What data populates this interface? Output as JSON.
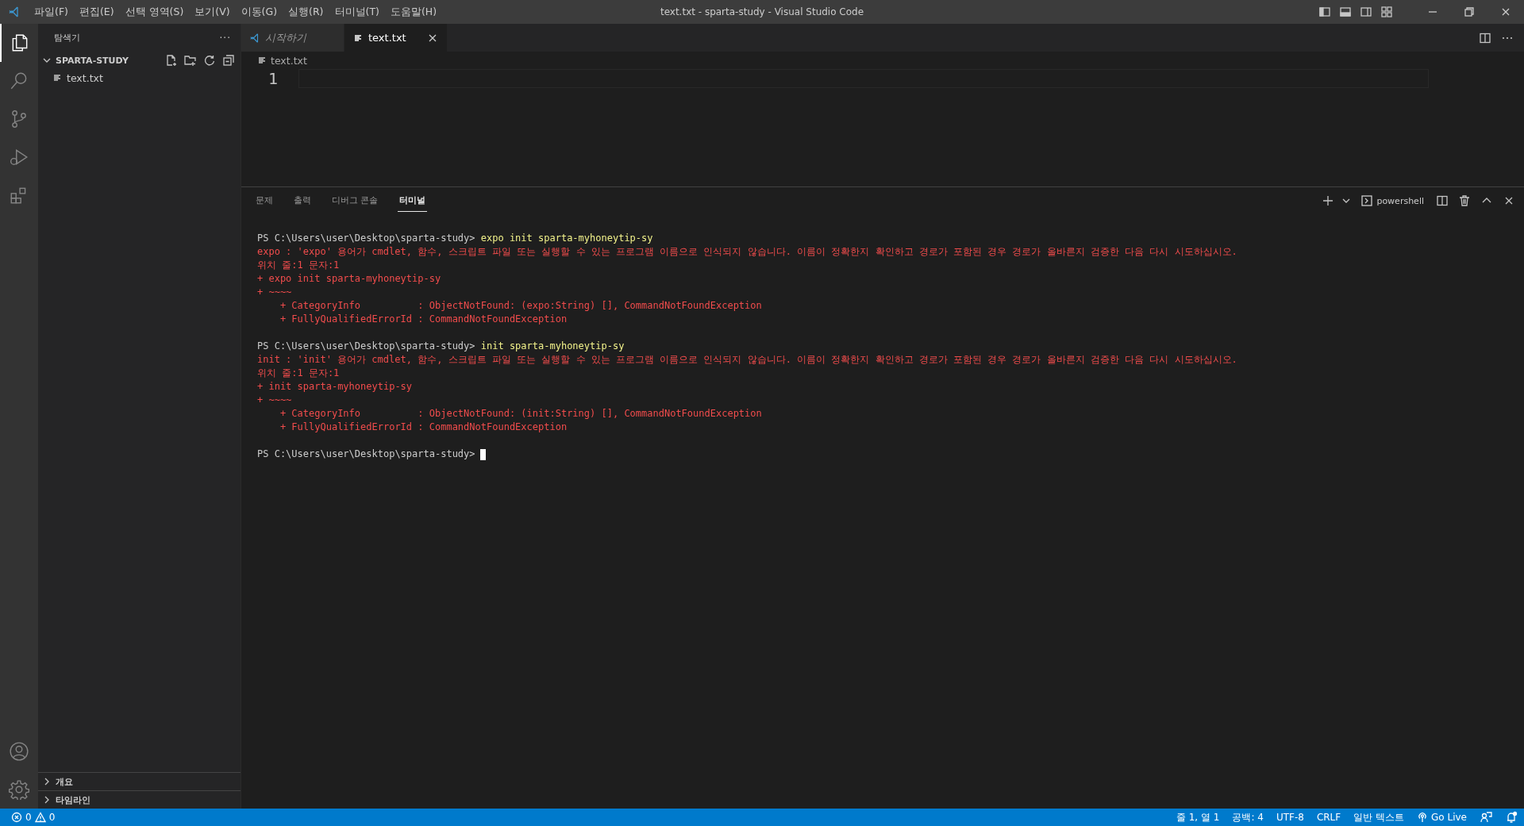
{
  "title_bar": {
    "menu": [
      "파일(F)",
      "편집(E)",
      "선택 영역(S)",
      "보기(V)",
      "이동(G)",
      "실행(R)",
      "터미널(T)",
      "도움말(H)"
    ],
    "title": "text.txt - sparta-study - Visual Studio Code"
  },
  "activity_bar": [
    {
      "kind": "files",
      "selected": true
    },
    {
      "kind": "search",
      "selected": false
    },
    {
      "kind": "source-control",
      "selected": false
    },
    {
      "kind": "run",
      "selected": false
    },
    {
      "kind": "extensions",
      "selected": false
    }
  ],
  "activity_bottom": [
    {
      "kind": "account"
    },
    {
      "kind": "settings"
    }
  ],
  "sidebar": {
    "title": "탐색기",
    "more": "···",
    "folder": {
      "name": "SPARTA-STUDY",
      "expanded": true,
      "children": [
        {
          "name": "text.txt"
        }
      ]
    },
    "sections": [
      {
        "name": "개요",
        "expanded": false
      },
      {
        "name": "타임라인",
        "expanded": false
      }
    ]
  },
  "tabs": [
    {
      "label": "시작하기",
      "kind": "welcome",
      "preview": true,
      "selected": false
    },
    {
      "label": "text.txt",
      "kind": "file",
      "preview": false,
      "selected": true
    }
  ],
  "breadcrumb": "text.txt",
  "editor": {
    "lines": [
      "1"
    ]
  },
  "panel": {
    "tabs": [
      {
        "label": "문제",
        "selected": false
      },
      {
        "label": "출력",
        "selected": false
      },
      {
        "label": "디버그 콘솔",
        "selected": false
      },
      {
        "label": "터미널",
        "selected": true
      }
    ],
    "shell": "powershell",
    "terminal": [
      [
        {
          "kind": "prompt",
          "path": "PS C:\\Users\\user\\Desktop\\sparta-study>",
          "command": "expo init sparta-myhoneytip-sy"
        },
        {
          "kind": "error",
          "text": "expo : 'expo' 용어가 cmdlet, 함수, 스크립트 파일 또는 실행할 수 있는 프로그램 이름으로 인식되지 않습니다. 이름이 정확한지 확인하고 경로가 포함된 경우 경로가 올바른지 검증한 다음 다시 시도하십시오."
        },
        {
          "kind": "error",
          "text": "위치 줄:1 문자:1"
        },
        {
          "kind": "error",
          "text": "+ expo init sparta-myhoneytip-sy"
        },
        {
          "kind": "error",
          "text": "+ ~~~~"
        },
        {
          "kind": "error",
          "text": "    + CategoryInfo          : ObjectNotFound: (expo:String) [], CommandNotFoundException"
        },
        {
          "kind": "error",
          "text": "    + FullyQualifiedErrorId : CommandNotFoundException"
        }
      ],
      [
        {
          "kind": "prompt",
          "path": "PS C:\\Users\\user\\Desktop\\sparta-study>",
          "command": "init sparta-myhoneytip-sy"
        },
        {
          "kind": "error",
          "text": "init : 'init' 용어가 cmdlet, 함수, 스크립트 파일 또는 실행할 수 있는 프로그램 이름으로 인식되지 않습니다. 이름이 정확한지 확인하고 경로가 포함된 경우 경로가 올바른지 검증한 다음 다시 시도하십시오."
        },
        {
          "kind": "error",
          "text": "위치 줄:1 문자:1"
        },
        {
          "kind": "error",
          "text": "+ init sparta-myhoneytip-sy"
        },
        {
          "kind": "error",
          "text": "+ ~~~~"
        },
        {
          "kind": "error",
          "text": "    + CategoryInfo          : ObjectNotFound: (init:String) [], CommandNotFoundException"
        },
        {
          "kind": "error",
          "text": "    + FullyQualifiedErrorId : CommandNotFoundException"
        }
      ],
      [
        {
          "kind": "prompt",
          "path": "PS C:\\Users\\user\\Desktop\\sparta-study>",
          "cursor": true
        }
      ]
    ]
  },
  "status_bar": {
    "errors": "0",
    "warnings": "0",
    "items": [
      {
        "kind": "text",
        "text": "줄 1, 열 1"
      },
      {
        "kind": "text",
        "text": "공백: 4"
      },
      {
        "kind": "text",
        "text": "UTF-8"
      },
      {
        "kind": "text",
        "text": "CRLF"
      },
      {
        "kind": "text",
        "text": "일반 텍스트"
      },
      {
        "kind": "golive",
        "text": "Go Live"
      },
      {
        "kind": "feedback"
      },
      {
        "kind": "bell"
      }
    ]
  }
}
